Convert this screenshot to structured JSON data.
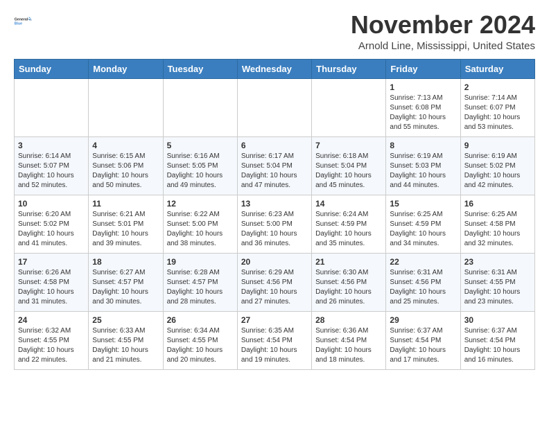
{
  "logo": {
    "line1": "General",
    "line2": "Blue"
  },
  "title": "November 2024",
  "subtitle": "Arnold Line, Mississippi, United States",
  "header": {
    "days": [
      "Sunday",
      "Monday",
      "Tuesday",
      "Wednesday",
      "Thursday",
      "Friday",
      "Saturday"
    ]
  },
  "weeks": [
    [
      {
        "day": "",
        "info": ""
      },
      {
        "day": "",
        "info": ""
      },
      {
        "day": "",
        "info": ""
      },
      {
        "day": "",
        "info": ""
      },
      {
        "day": "",
        "info": ""
      },
      {
        "day": "1",
        "info": "Sunrise: 7:13 AM\nSunset: 6:08 PM\nDaylight: 10 hours\nand 55 minutes."
      },
      {
        "day": "2",
        "info": "Sunrise: 7:14 AM\nSunset: 6:07 PM\nDaylight: 10 hours\nand 53 minutes."
      }
    ],
    [
      {
        "day": "3",
        "info": "Sunrise: 6:14 AM\nSunset: 5:07 PM\nDaylight: 10 hours\nand 52 minutes."
      },
      {
        "day": "4",
        "info": "Sunrise: 6:15 AM\nSunset: 5:06 PM\nDaylight: 10 hours\nand 50 minutes."
      },
      {
        "day": "5",
        "info": "Sunrise: 6:16 AM\nSunset: 5:05 PM\nDaylight: 10 hours\nand 49 minutes."
      },
      {
        "day": "6",
        "info": "Sunrise: 6:17 AM\nSunset: 5:04 PM\nDaylight: 10 hours\nand 47 minutes."
      },
      {
        "day": "7",
        "info": "Sunrise: 6:18 AM\nSunset: 5:04 PM\nDaylight: 10 hours\nand 45 minutes."
      },
      {
        "day": "8",
        "info": "Sunrise: 6:19 AM\nSunset: 5:03 PM\nDaylight: 10 hours\nand 44 minutes."
      },
      {
        "day": "9",
        "info": "Sunrise: 6:19 AM\nSunset: 5:02 PM\nDaylight: 10 hours\nand 42 minutes."
      }
    ],
    [
      {
        "day": "10",
        "info": "Sunrise: 6:20 AM\nSunset: 5:02 PM\nDaylight: 10 hours\nand 41 minutes."
      },
      {
        "day": "11",
        "info": "Sunrise: 6:21 AM\nSunset: 5:01 PM\nDaylight: 10 hours\nand 39 minutes."
      },
      {
        "day": "12",
        "info": "Sunrise: 6:22 AM\nSunset: 5:00 PM\nDaylight: 10 hours\nand 38 minutes."
      },
      {
        "day": "13",
        "info": "Sunrise: 6:23 AM\nSunset: 5:00 PM\nDaylight: 10 hours\nand 36 minutes."
      },
      {
        "day": "14",
        "info": "Sunrise: 6:24 AM\nSunset: 4:59 PM\nDaylight: 10 hours\nand 35 minutes."
      },
      {
        "day": "15",
        "info": "Sunrise: 6:25 AM\nSunset: 4:59 PM\nDaylight: 10 hours\nand 34 minutes."
      },
      {
        "day": "16",
        "info": "Sunrise: 6:25 AM\nSunset: 4:58 PM\nDaylight: 10 hours\nand 32 minutes."
      }
    ],
    [
      {
        "day": "17",
        "info": "Sunrise: 6:26 AM\nSunset: 4:58 PM\nDaylight: 10 hours\nand 31 minutes."
      },
      {
        "day": "18",
        "info": "Sunrise: 6:27 AM\nSunset: 4:57 PM\nDaylight: 10 hours\nand 30 minutes."
      },
      {
        "day": "19",
        "info": "Sunrise: 6:28 AM\nSunset: 4:57 PM\nDaylight: 10 hours\nand 28 minutes."
      },
      {
        "day": "20",
        "info": "Sunrise: 6:29 AM\nSunset: 4:56 PM\nDaylight: 10 hours\nand 27 minutes."
      },
      {
        "day": "21",
        "info": "Sunrise: 6:30 AM\nSunset: 4:56 PM\nDaylight: 10 hours\nand 26 minutes."
      },
      {
        "day": "22",
        "info": "Sunrise: 6:31 AM\nSunset: 4:56 PM\nDaylight: 10 hours\nand 25 minutes."
      },
      {
        "day": "23",
        "info": "Sunrise: 6:31 AM\nSunset: 4:55 PM\nDaylight: 10 hours\nand 23 minutes."
      }
    ],
    [
      {
        "day": "24",
        "info": "Sunrise: 6:32 AM\nSunset: 4:55 PM\nDaylight: 10 hours\nand 22 minutes."
      },
      {
        "day": "25",
        "info": "Sunrise: 6:33 AM\nSunset: 4:55 PM\nDaylight: 10 hours\nand 21 minutes."
      },
      {
        "day": "26",
        "info": "Sunrise: 6:34 AM\nSunset: 4:55 PM\nDaylight: 10 hours\nand 20 minutes."
      },
      {
        "day": "27",
        "info": "Sunrise: 6:35 AM\nSunset: 4:54 PM\nDaylight: 10 hours\nand 19 minutes."
      },
      {
        "day": "28",
        "info": "Sunrise: 6:36 AM\nSunset: 4:54 PM\nDaylight: 10 hours\nand 18 minutes."
      },
      {
        "day": "29",
        "info": "Sunrise: 6:37 AM\nSunset: 4:54 PM\nDaylight: 10 hours\nand 17 minutes."
      },
      {
        "day": "30",
        "info": "Sunrise: 6:37 AM\nSunset: 4:54 PM\nDaylight: 10 hours\nand 16 minutes."
      }
    ]
  ]
}
